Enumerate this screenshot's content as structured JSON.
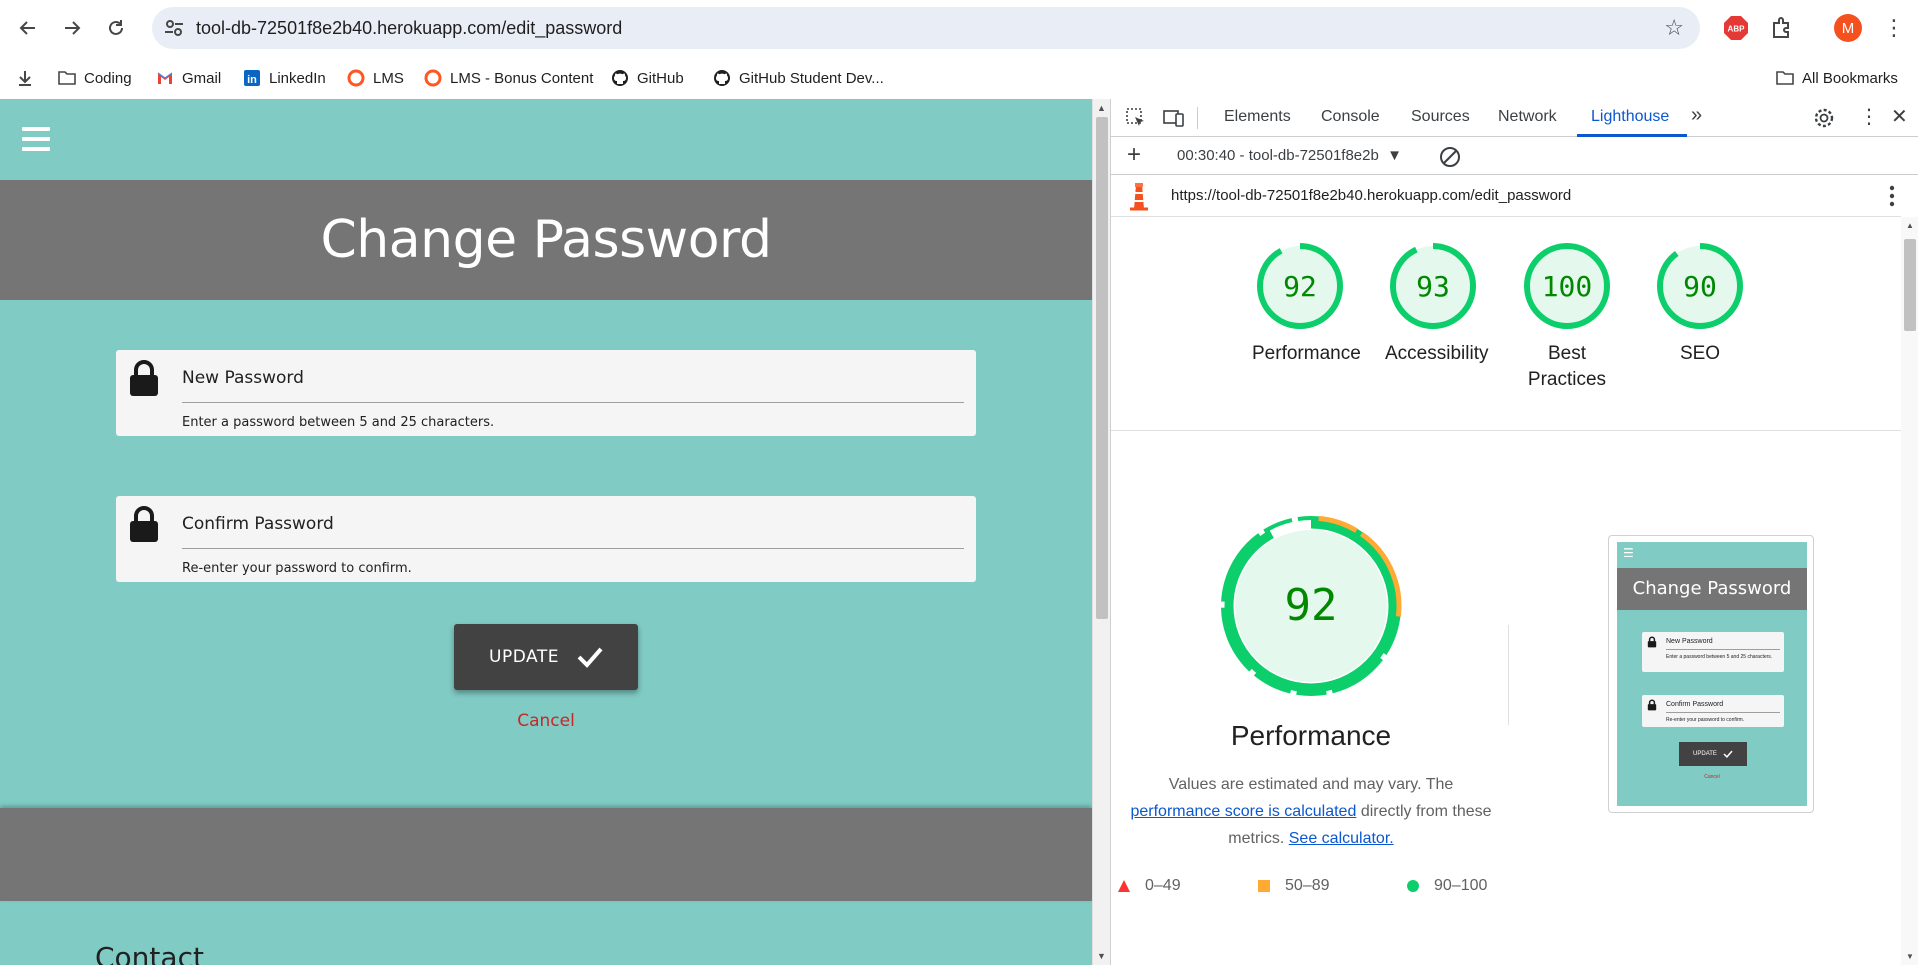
{
  "browser": {
    "url": "tool-db-72501f8e2b40.herokuapp.com/edit_password",
    "profile_initial": "M",
    "extension_abp": "ABP",
    "bookmarks": [
      {
        "label": "Coding",
        "icon": "folder-icon"
      },
      {
        "label": "Gmail",
        "icon": "gmail-icon"
      },
      {
        "label": "LinkedIn",
        "icon": "linkedin-icon"
      },
      {
        "label": "LMS",
        "icon": "lms-icon"
      },
      {
        "label": "LMS - Bonus Content",
        "icon": "lms-icon"
      },
      {
        "label": "GitHub",
        "icon": "github-icon"
      },
      {
        "label": "GitHub Student Dev...",
        "icon": "github-icon"
      }
    ],
    "all_bookmarks": "All Bookmarks"
  },
  "page": {
    "title": "Change Password",
    "new_password": {
      "label": "New Password",
      "helper": "Enter a password between 5 and 25 characters."
    },
    "confirm_password": {
      "label": "Confirm Password",
      "helper": "Re-enter your password to confirm."
    },
    "update_label": "UPDATE",
    "cancel_label": "Cancel",
    "footer_heading": "Contact",
    "colors": {
      "teal": "#80cbc4",
      "band": "#757575",
      "button": "#424242",
      "cancel": "#c62828"
    }
  },
  "devtools": {
    "tabs": [
      "Elements",
      "Console",
      "Sources",
      "Network",
      "Lighthouse"
    ],
    "active_tab": "Lighthouse",
    "report_selector": "00:30:40 - tool-db-72501f8e2b",
    "report_url": "https://tool-db-72501f8e2b40.herokuapp.com/edit_password",
    "scores": [
      {
        "label": "Performance",
        "value": 92
      },
      {
        "label": "Accessibility",
        "value": 93
      },
      {
        "label": "Best Practices",
        "value": 100
      },
      {
        "label": "SEO",
        "value": 90
      }
    ],
    "performance": {
      "score": 92,
      "title": "Performance",
      "desc_1": "Values are estimated and may vary. The",
      "desc_link_1": "performance score is calculated",
      "desc_2": "directly from these metrics.",
      "desc_link_2": "See calculator."
    },
    "legend": [
      {
        "range": "0–49",
        "shape": "triangle",
        "color": "#ff3333"
      },
      {
        "range": "50–89",
        "shape": "square",
        "color": "#ffaa33"
      },
      {
        "range": "90–100",
        "shape": "circle",
        "color": "#0cce6b"
      }
    ],
    "colors": {
      "pass": "#0cce6b",
      "pass_text": "#008800",
      "pass_bg": "#e5f8ee",
      "average": "#ffaa33",
      "accent": "#0b57d0"
    }
  }
}
